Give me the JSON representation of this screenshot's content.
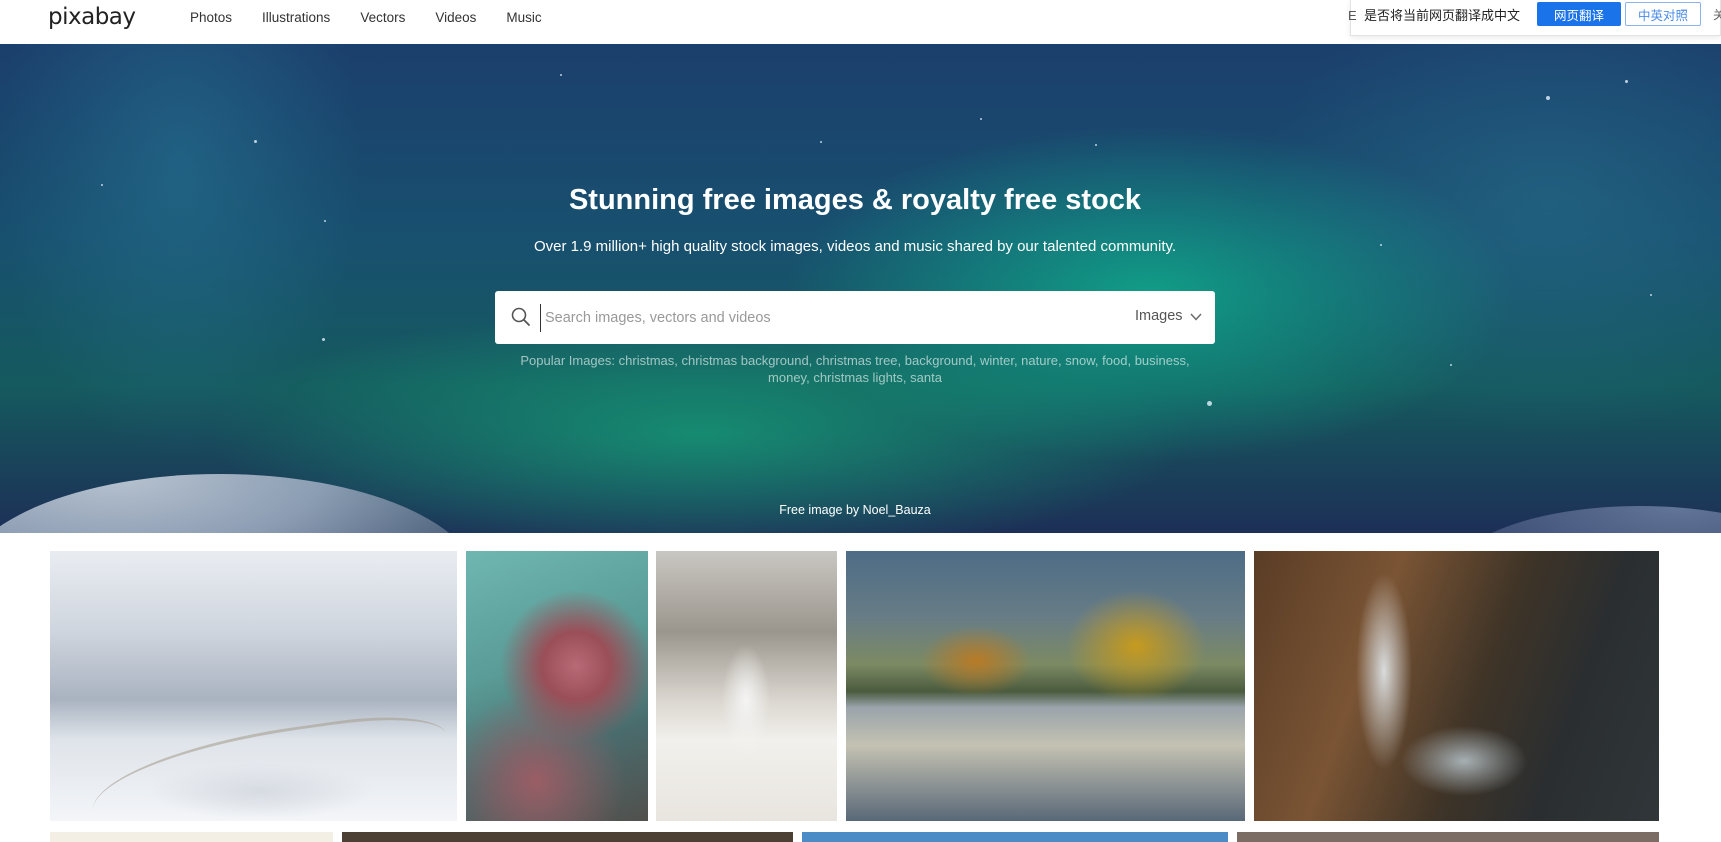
{
  "header": {
    "logo": "pixabay",
    "nav": [
      "Photos",
      "Illustrations",
      "Vectors",
      "Videos",
      "Music"
    ]
  },
  "translate_bar": {
    "edge_char": "E",
    "question": "是否将当前网页翻译成中文",
    "translate_button": "网页翻译",
    "bilingual_button": "中英对照",
    "edge_right": "关"
  },
  "hero": {
    "title": "Stunning free images & royalty free stock",
    "subtitle": "Over 1.9 million+ high quality stock images, videos and music shared by our talented community.",
    "search": {
      "placeholder": "Search images, vectors and videos",
      "type": "Images"
    },
    "popular": {
      "label": "Popular Images:",
      "terms": [
        "christmas",
        "christmas background",
        "christmas tree",
        "background",
        "winter",
        "nature",
        "snow",
        "food",
        "business",
        "money",
        "christmas lights",
        "santa"
      ]
    },
    "credit": "Free image by Noel_Bauza"
  },
  "colors": {
    "accent": "#1a73e8",
    "hero_top": "#1b3f6c",
    "hero_glow": "#10aa8c"
  }
}
